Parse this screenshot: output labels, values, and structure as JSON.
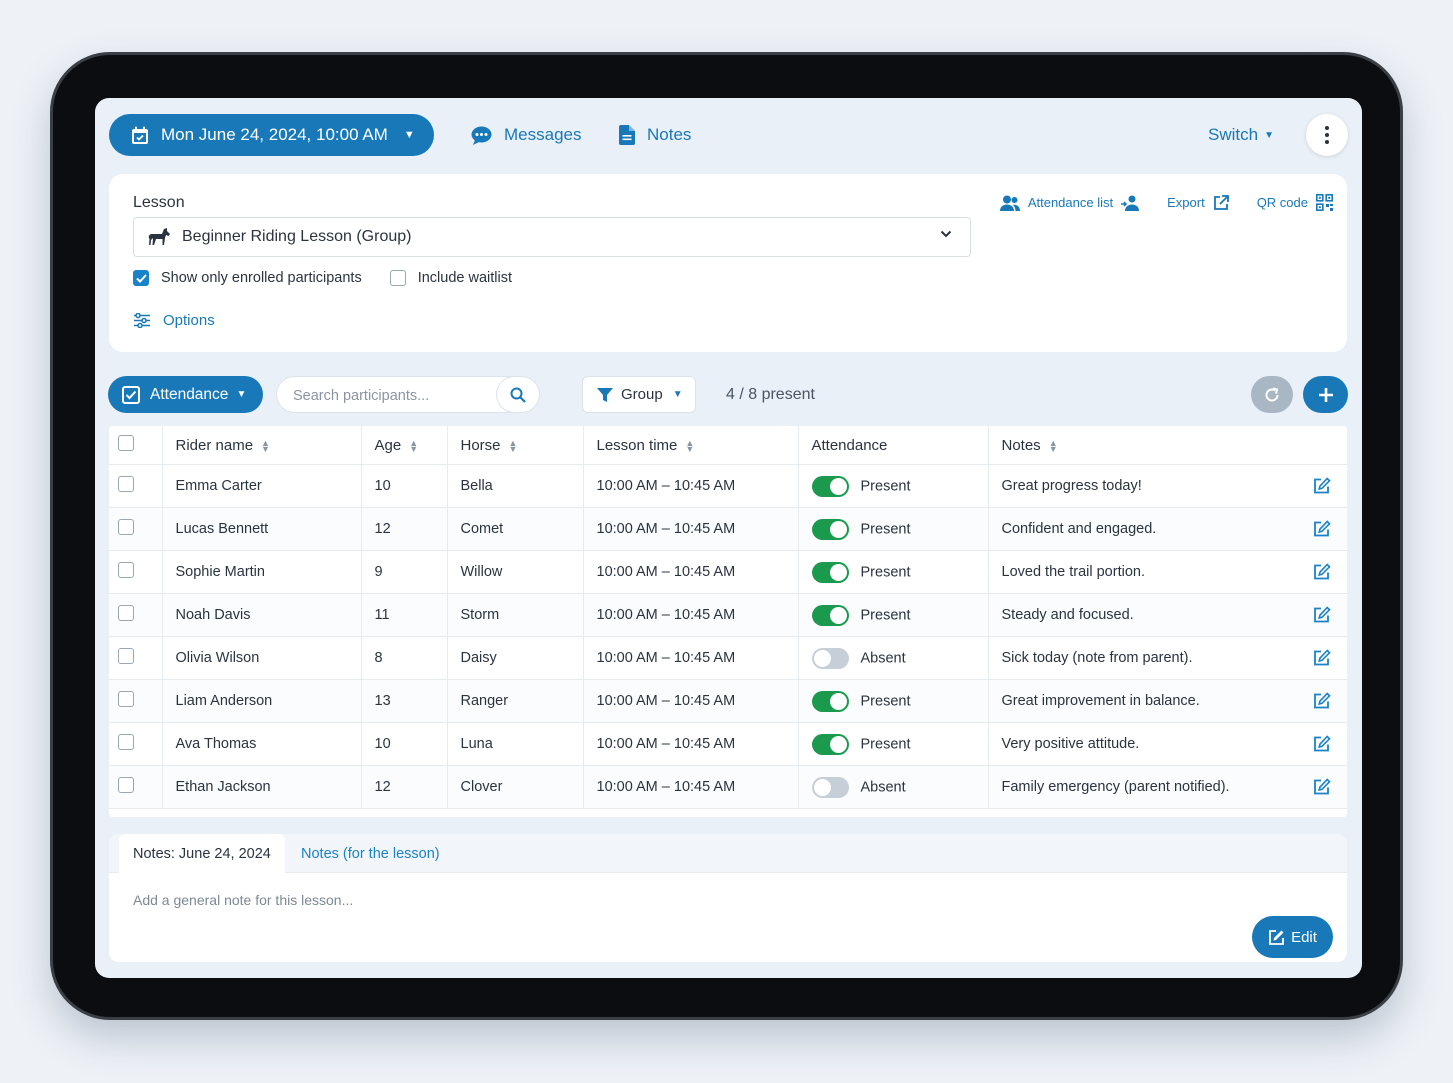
{
  "topbar": {
    "date_label": "Mon June 24, 2024, 10:00 AM",
    "messages_label": "Messages",
    "notes_label": "Notes",
    "switch_label": "Switch"
  },
  "lesson": {
    "label": "Lesson",
    "selected": "Beginner Riding Lesson (Group)",
    "show_enrolled_label": "Show only enrolled participants",
    "show_enrolled_checked": true,
    "include_waitlist_label": "Include waitlist",
    "include_waitlist_checked": false,
    "options_label": "Options"
  },
  "actions": {
    "attendance_list": "Attendance list",
    "export": "Export",
    "qr_code": "QR code"
  },
  "toolbar": {
    "attendance_label": "Attendance",
    "search_placeholder": "Search participants...",
    "group_label": "Group",
    "present_count": "4 / 8 present"
  },
  "table": {
    "headers": {
      "rider": "Rider name",
      "age": "Age",
      "horse": "Horse",
      "time": "Lesson time",
      "attendance": "Attendance",
      "notes": "Notes"
    },
    "rows": [
      {
        "rider": "Emma Carter",
        "age": "10",
        "horse": "Bella",
        "time": "10:00 AM – 10:45 AM",
        "present": true,
        "status": "Present",
        "note": "Great progress today!"
      },
      {
        "rider": "Lucas Bennett",
        "age": "12",
        "horse": "Comet",
        "time": "10:00 AM – 10:45 AM",
        "present": true,
        "status": "Present",
        "note": "Confident and engaged."
      },
      {
        "rider": "Sophie Martin",
        "age": "9",
        "horse": "Willow",
        "time": "10:00 AM – 10:45 AM",
        "present": true,
        "status": "Present",
        "note": "Loved the trail portion."
      },
      {
        "rider": "Noah Davis",
        "age": "11",
        "horse": "Storm",
        "time": "10:00 AM – 10:45 AM",
        "present": true,
        "status": "Present",
        "note": "Steady and focused."
      },
      {
        "rider": "Olivia Wilson",
        "age": "8",
        "horse": "Daisy",
        "time": "10:00 AM – 10:45 AM",
        "present": false,
        "status": "Absent",
        "note": "Sick today (note from parent)."
      },
      {
        "rider": "Liam Anderson",
        "age": "13",
        "horse": "Ranger",
        "time": "10:00 AM – 10:45 AM",
        "present": true,
        "status": "Present",
        "note": "Great improvement in balance."
      },
      {
        "rider": "Ava Thomas",
        "age": "10",
        "horse": "Luna",
        "time": "10:00 AM – 10:45 AM",
        "present": true,
        "status": "Present",
        "note": "Very positive attitude."
      },
      {
        "rider": "Ethan Jackson",
        "age": "12",
        "horse": "Clover",
        "time": "10:00 AM – 10:45 AM",
        "present": false,
        "status": "Absent",
        "note": "Family emergency (parent notified)."
      }
    ]
  },
  "notes_panel": {
    "tab_active": "Notes: June 24, 2024",
    "tab_other": "Notes (for the lesson)",
    "placeholder": "Add a general note for this lesson...",
    "edit_label": "Edit"
  },
  "colors": {
    "primary": "#1878b8",
    "toggle_on": "#1b9a4e",
    "toggle_off": "#c6ced8"
  }
}
